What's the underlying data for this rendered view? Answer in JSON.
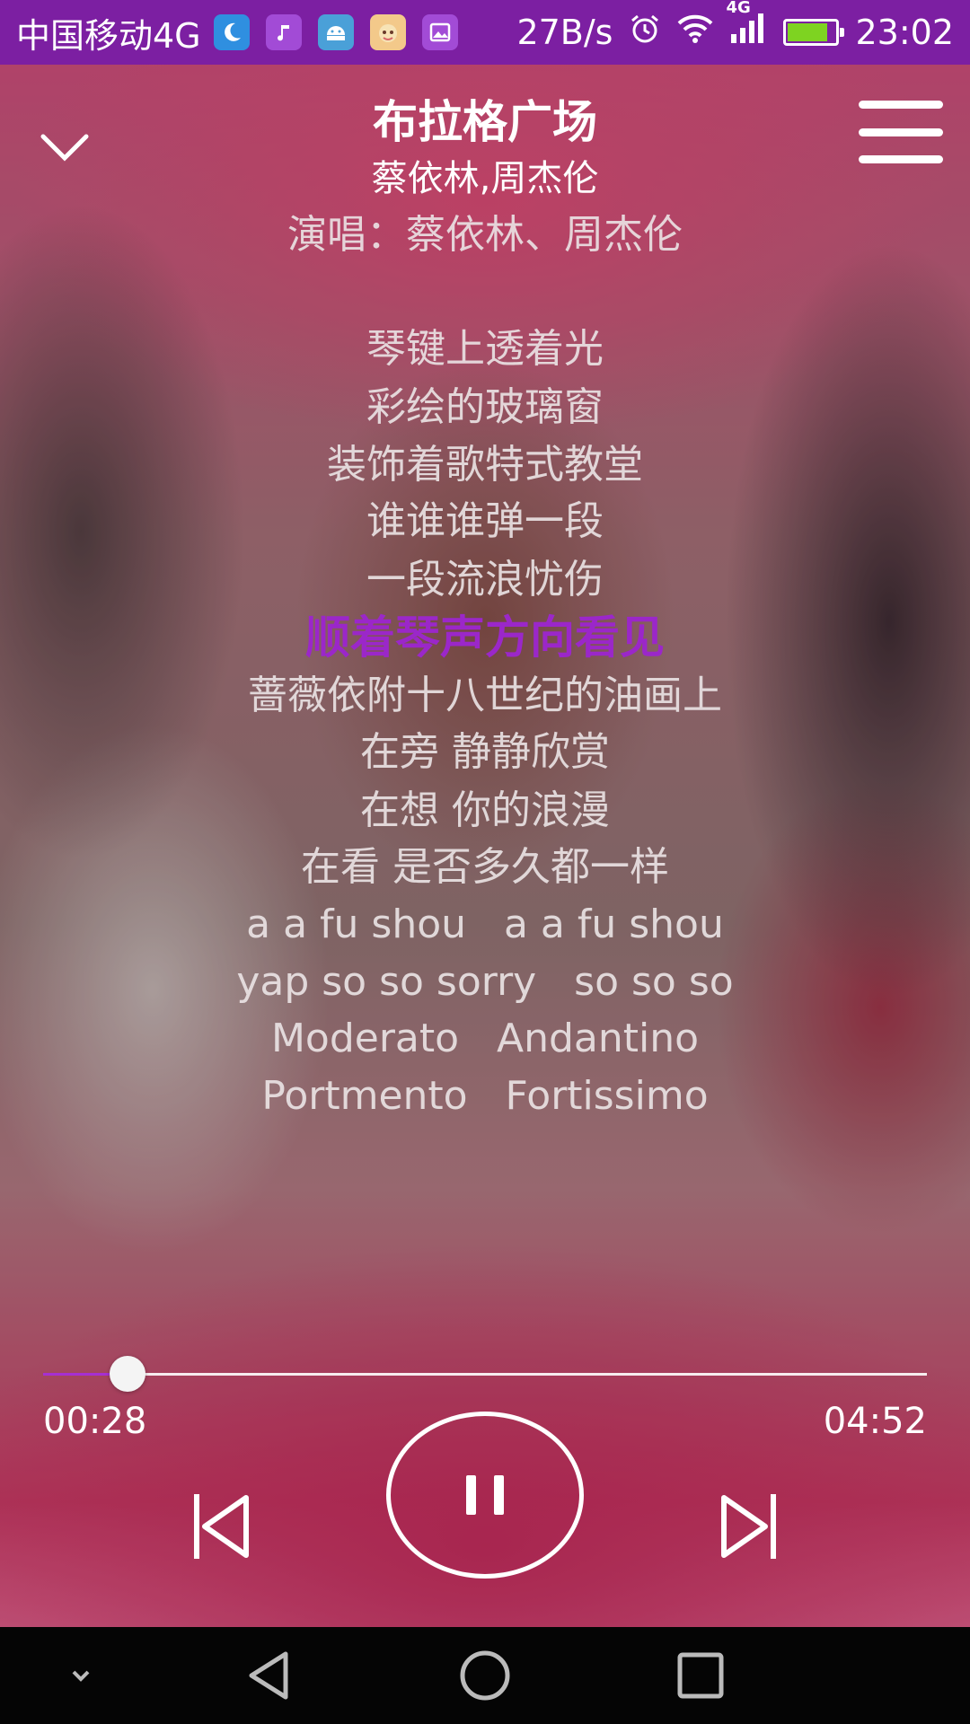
{
  "status_bar": {
    "carrier": "中国移动4G",
    "network_speed": "27B/s",
    "network_type": "4G",
    "time": "23:02",
    "battery_level": 0.85,
    "icons": [
      "moon-icon",
      "music-icon",
      "android-icon",
      "pet-icon",
      "gallery-icon",
      "alarm-icon",
      "wifi-icon",
      "signal-icon",
      "battery-icon"
    ]
  },
  "header": {
    "title": "布拉格广场",
    "artist": "蔡依林,周杰伦"
  },
  "lyrics": {
    "lines": [
      "布拉格广场",
      "演唱：蔡依林、周杰伦",
      "",
      "琴键上透着光",
      "彩绘的玻璃窗",
      "装饰着歌特式教堂",
      "谁谁谁弹一段",
      "一段流浪忧伤",
      "顺着琴声方向看见",
      "蔷薇依附十八世纪的油画上",
      "在旁 静静欣赏",
      "在想 你的浪漫",
      "在看 是否多久都一样",
      "a a fu shou   a a fu shou",
      "yap so so sorry   so so so",
      "Moderato   Andantino",
      "Portmento   Fortissimo"
    ],
    "current_index": 8
  },
  "player": {
    "elapsed": "00:28",
    "total": "04:52",
    "progress": 0.0959
  },
  "colors": {
    "status_bar": "#7c1fa2",
    "highlight": "#9b27c9",
    "progress_fill": "#a62fd1",
    "nav_bar": "#050505"
  }
}
